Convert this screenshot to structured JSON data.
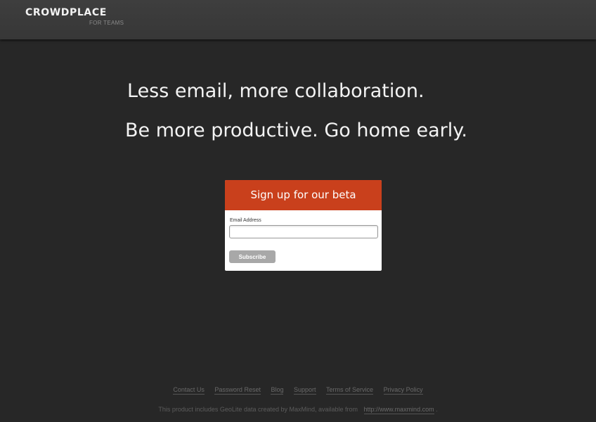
{
  "header": {
    "logo": "CROWDPLACE",
    "logo_sub": "FOR TEAMS"
  },
  "hero": {
    "line1": "Less email, more collaboration.",
    "line2": "Be more productive. Go home early."
  },
  "signup": {
    "title": "Sign up for our beta",
    "email_label": "Email Address",
    "email_value": "",
    "email_placeholder": "",
    "subscribe_label": "Subscribe"
  },
  "footer": {
    "links": [
      "Contact Us",
      "Password Reset",
      "Blog",
      "Support",
      "Terms of Service",
      "Privacy Policy"
    ],
    "note": "This product includes GeoLite data created by MaxMind, available from",
    "note_link": "http://www.maxmind.com",
    "note_end": "."
  },
  "colors": {
    "background": "#272727",
    "header": "#3b3b3b",
    "accent": "#c9401c",
    "button": "#a8a8a8"
  }
}
